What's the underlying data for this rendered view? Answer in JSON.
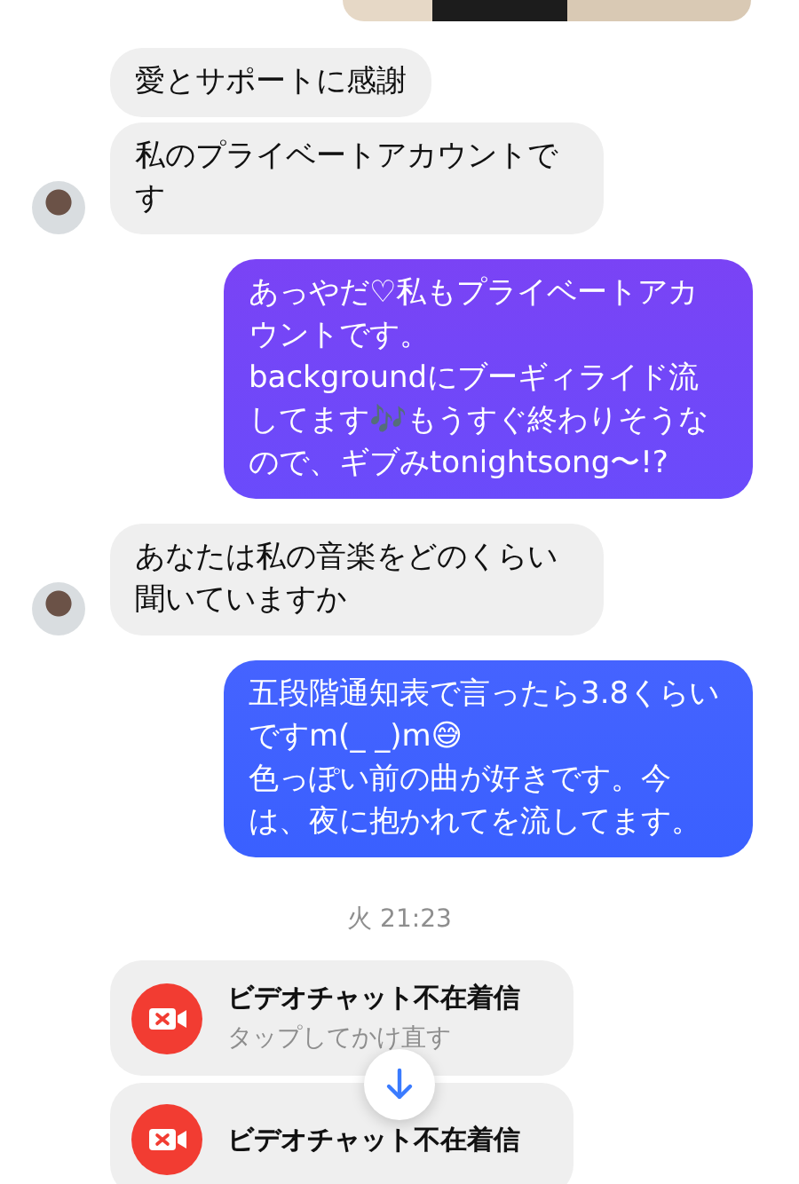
{
  "messages": [
    {
      "kind": "outgoing_photo"
    },
    {
      "kind": "incoming_text",
      "avatar": false,
      "text": "愛とサポートに感謝"
    },
    {
      "kind": "incoming_text",
      "avatar": true,
      "text": "私のプライベートアカウントです"
    },
    {
      "kind": "outgoing_text",
      "text": "あっやだ♡私もプライベートアカウントです。\nbackgroundにブーギィライド流してます🎶もうすぐ終わりそうなので、ギブみtonightsong〜!?"
    },
    {
      "kind": "incoming_text",
      "avatar": true,
      "text": "あなたは私の音楽をどのくらい聞いていますか"
    },
    {
      "kind": "outgoing_text",
      "text": "五段階通知表で言ったら3.8くらいですm(_ _)m😅\n色っぽい前の曲が好きです。今は、夜に抱かれてを流してます。"
    },
    {
      "kind": "timestamp",
      "text": "火 21:23"
    },
    {
      "kind": "missed_video_call",
      "title": "ビデオチャット不在着信",
      "subtitle": "タップしてかけ直す"
    },
    {
      "kind": "missed_video_call",
      "title": "ビデオチャット不在着信"
    }
  ]
}
